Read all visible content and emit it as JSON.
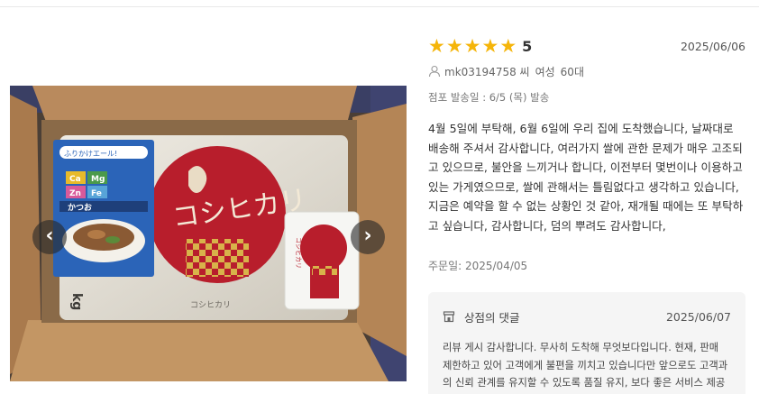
{
  "review": {
    "rating": 5,
    "score_label": "5",
    "date": "2025/06/06",
    "user_id": "mk03194758 씨",
    "gender": "여성",
    "age": "60대",
    "shipping": "점포 발송일 : 6/5 (목) 발송",
    "body": "4월 5일에 부탁해, 6월 6일에 우리 집에 도착했습니다, 날짜대로 배송해 주셔서 감사합니다, 여러가지 쌀에 관한 문제가 매우 고조되고 있으므로, 불안을 느끼거나 합니다, 이전부터 몇번이나 이용하고 있는 가게였으므로, 쌀에 관해서는 틀림없다고 생각하고 있습니다, 지금은 예약을 할 수 없는 상황인 것 같아, 재개될 때에는 또 부탁하고 싶습니다, 감사합니다, 덤의 뿌려도 감사합니다,",
    "order_date": "주문일: 2025/04/05"
  },
  "reply": {
    "title": "상점의 댓글",
    "date": "2025/06/07",
    "text": "리뷰 게시 감사합니다. 무사히 도착해 무엇보다입니다. 현재, 판매 제한하고 있어 고객에게 불편을 끼치고 있습니다만 앞으로도 고객과의 신뢰 관계를 유지할 수 있도록 품질 유지, 보다 좋은 서비스 제공도 노력해 가기 때문에 잘 부탁드립니다."
  },
  "photo": {
    "package_text": "ふりかけエール!",
    "minerals": [
      "Ca",
      "Mg",
      "Zn",
      "Fe"
    ],
    "flavor": "かつお",
    "rice_brand": "コシヒカリ",
    "pack_label": "コシヒカリ",
    "bag_side_text": "コシヒカリ",
    "weight_mark": "kg"
  },
  "controls": {
    "prev": "‹",
    "next": "›"
  },
  "colors": {
    "star": "#f5b50a",
    "reply_bg": "#f5f5f5",
    "rice_red": "#b81e2c"
  }
}
